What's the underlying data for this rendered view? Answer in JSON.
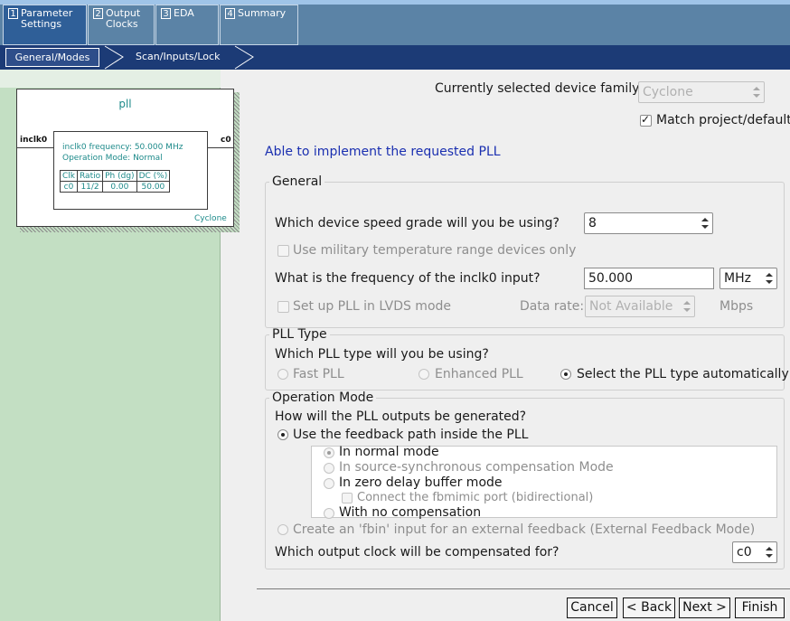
{
  "steps": [
    {
      "num": "1",
      "label_line1": "Parameter",
      "label_line2": "Settings"
    },
    {
      "num": "2",
      "label_line1": "Output",
      "label_line2": "Clocks"
    },
    {
      "num": "3",
      "label_line1": "EDA",
      "label_line2": ""
    },
    {
      "num": "4",
      "label_line1": "Summary",
      "label_line2": ""
    }
  ],
  "subnav": {
    "general": "General/Modes",
    "scan": "Scan/Inputs/Lock"
  },
  "diagram": {
    "title": "pll",
    "input_pin": "inclk0",
    "output_pin": "c0",
    "frequency_text": "inclk0 frequency: 50.000 MHz",
    "mode_text": "Operation Mode: Normal",
    "table_headers": [
      "Clk",
      "Ratio",
      "Ph (dg)",
      "DC (%)"
    ],
    "table_row": [
      "c0",
      "11/2",
      "0.00",
      "50.00"
    ],
    "family": "Cyclone"
  },
  "device": {
    "family_label": "Currently selected device family:",
    "family_value": "Cyclone",
    "match_label": "Match project/default",
    "status": "Able to implement the requested PLL"
  },
  "general": {
    "legend": "General",
    "speed_grade_label": "Which device speed grade will you be using?",
    "speed_grade_value": "8",
    "military_label": "Use military temperature range devices only",
    "freq_label": "What is the frequency of the inclk0 input?",
    "freq_value": "50.000",
    "freq_unit": "MHz",
    "lvds_label": "Set up PLL in LVDS mode",
    "data_rate_label": "Data rate:",
    "data_rate_value": "Not Available",
    "data_rate_unit": "Mbps"
  },
  "pll_type": {
    "legend": "PLL Type",
    "question": "Which PLL type will you be using?",
    "fast": "Fast PLL",
    "enhanced": "Enhanced PLL",
    "auto": "Select the PLL type automatically"
  },
  "operation_mode": {
    "legend": "Operation Mode",
    "question": "How will the PLL outputs be generated?",
    "feedback_path": "Use the feedback path inside the PLL",
    "normal": "In normal mode",
    "source_sync": "In source-synchronous compensation Mode",
    "zero_delay": "In zero delay buffer mode",
    "fbmimic": "Connect the fbmimic port (bidirectional)",
    "no_comp": "With no compensation",
    "fbin": "Create an 'fbin' input for an external feedback (External Feedback Mode)",
    "compensated_label": "Which output clock will be compensated for?",
    "compensated_value": "c0"
  },
  "buttons": {
    "cancel": "Cancel",
    "back": "< Back",
    "next": "Next >",
    "finish": "Finish"
  }
}
